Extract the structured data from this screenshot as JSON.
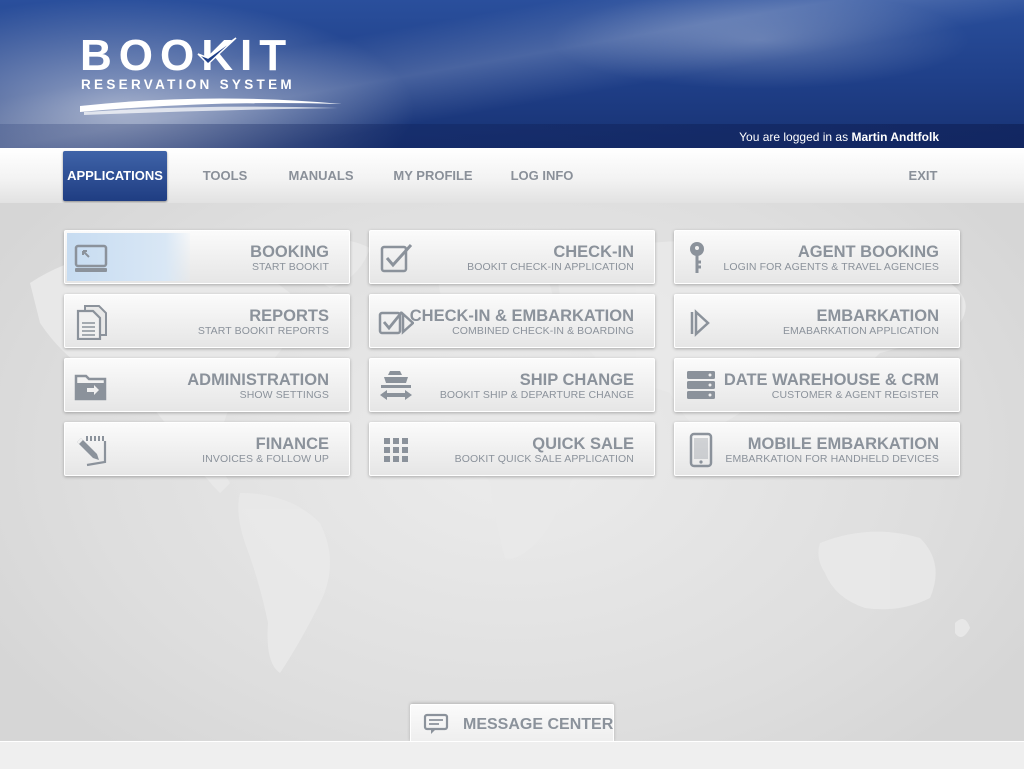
{
  "brand": {
    "title": "BOOKIT",
    "subtitle": "RESERVATION SYSTEM"
  },
  "session": {
    "prefix": "You are logged in as",
    "user": "Martin Andtfolk"
  },
  "nav": {
    "applications": "APPLICATIONS",
    "tools": "TOOLS",
    "manuals": "MANUALS",
    "my_profile": "MY PROFILE",
    "log_info": "LOG INFO",
    "exit": "EXIT",
    "active": "applications"
  },
  "tiles": [
    {
      "title": "BOOKING",
      "subtitle": "START BOOKIT",
      "icon": "computer-icon"
    },
    {
      "title": "CHECK-IN",
      "subtitle": "BOOKIT CHECK-IN APPLICATION",
      "icon": "checkbox-icon"
    },
    {
      "title": "AGENT BOOKING",
      "subtitle": "LOGIN FOR AGENTS & TRAVEL AGENCIES",
      "icon": "key-icon"
    },
    {
      "title": "REPORTS",
      "subtitle": "START BOOKIT REPORTS",
      "icon": "documents-icon"
    },
    {
      "title": "CHECK-IN & EMBARKATION",
      "subtitle": "COMBINED CHECK-IN & BOARDING",
      "icon": "check-arrow-icon"
    },
    {
      "title": "EMBARKATION",
      "subtitle": "EMABARKATION APPLICATION",
      "icon": "embark-arrow-icon"
    },
    {
      "title": "ADMINISTRATION",
      "subtitle": "SHOW SETTINGS",
      "icon": "folder-icon"
    },
    {
      "title": "SHIP CHANGE",
      "subtitle": "BOOKIT SHIP & DEPARTURE CHANGE",
      "icon": "ship-swap-icon"
    },
    {
      "title": "DATE WAREHOUSE & CRM",
      "subtitle": "CUSTOMER & AGENT REGISTER",
      "icon": "server-icon"
    },
    {
      "title": "FINANCE",
      "subtitle": "INVOICES & FOLLOW UP",
      "icon": "pencil-notepad-icon"
    },
    {
      "title": "QUICK SALE",
      "subtitle": "BOOKIT QUICK SALE APPLICATION",
      "icon": "grid-icon"
    },
    {
      "title": "MOBILE EMBARKATION",
      "subtitle": "EMBARKATION FOR HANDHELD DEVICES",
      "icon": "mobile-phone-icon"
    }
  ],
  "message_center": {
    "label": "MESSAGE CENTER",
    "icon": "chat-icon"
  },
  "colors": {
    "accent": "#2a4f9c",
    "tile_text": "#8b929b",
    "nav_text": "#8a9099"
  }
}
